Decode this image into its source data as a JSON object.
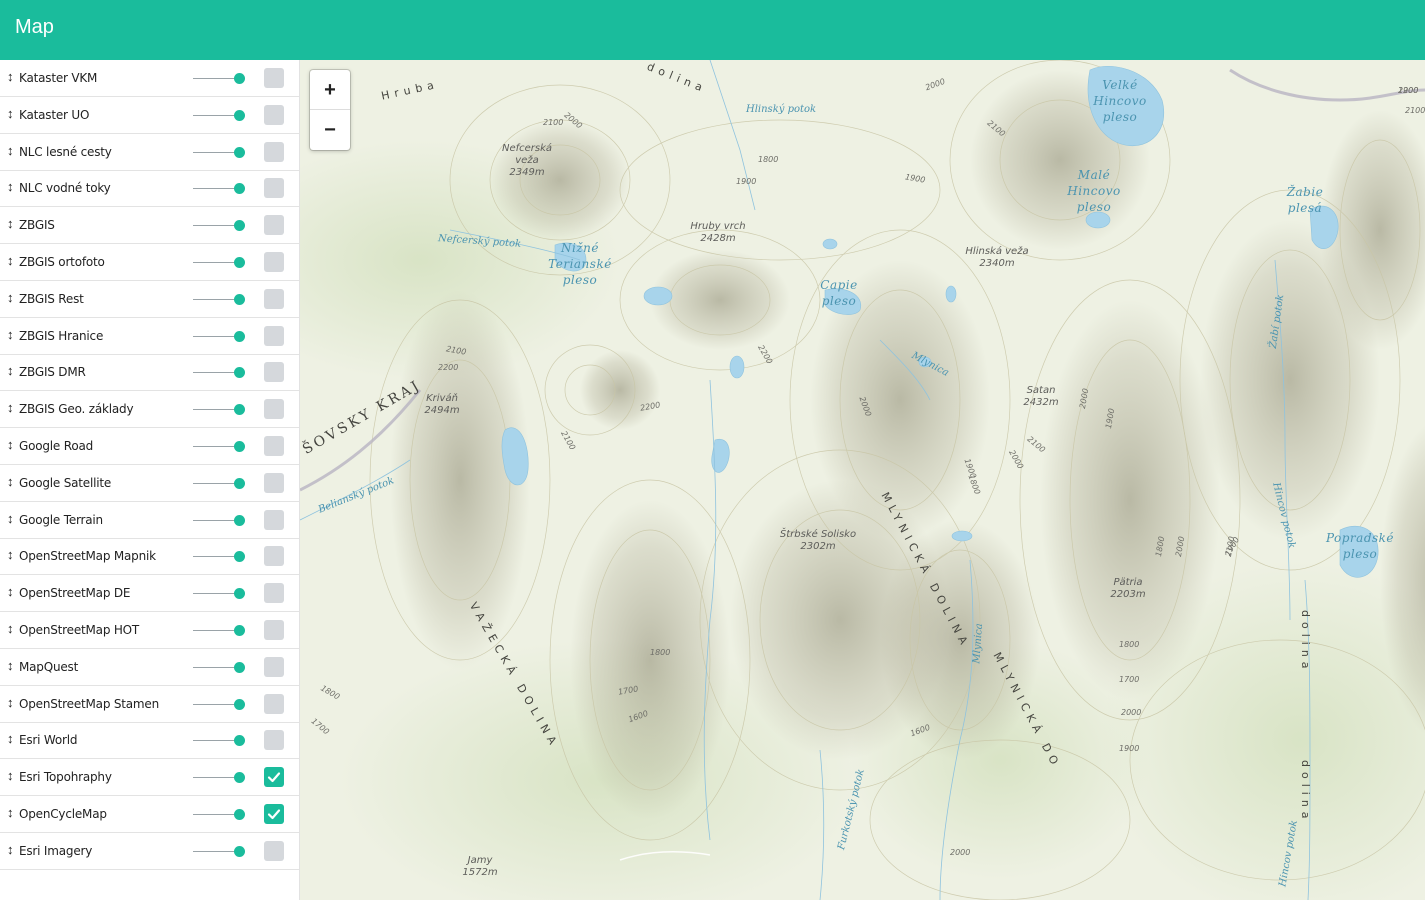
{
  "header": {
    "title": "Map"
  },
  "layers": [
    {
      "name": "Kataster VKM",
      "checked": false
    },
    {
      "name": "Kataster UO",
      "checked": false
    },
    {
      "name": "NLC lesné cesty",
      "checked": false
    },
    {
      "name": "NLC vodné toky",
      "checked": false
    },
    {
      "name": "ZBGIS",
      "checked": false
    },
    {
      "name": "ZBGIS ortofoto",
      "checked": false
    },
    {
      "name": "ZBGIS Rest",
      "checked": false
    },
    {
      "name": "ZBGIS Hranice",
      "checked": false
    },
    {
      "name": "ZBGIS DMR",
      "checked": false
    },
    {
      "name": "ZBGIS Geo. základy",
      "checked": false
    },
    {
      "name": "Google Road",
      "checked": false
    },
    {
      "name": "Google Satellite",
      "checked": false
    },
    {
      "name": "Google Terrain",
      "checked": false
    },
    {
      "name": "OpenStreetMap Mapnik",
      "checked": false
    },
    {
      "name": "OpenStreetMap DE",
      "checked": false
    },
    {
      "name": "OpenStreetMap HOT",
      "checked": false
    },
    {
      "name": "MapQuest",
      "checked": false
    },
    {
      "name": "OpenStreetMap Stamen",
      "checked": false
    },
    {
      "name": "Esri World",
      "checked": false
    },
    {
      "name": "Esri Topohraphy",
      "checked": true
    },
    {
      "name": "OpenCycleMap",
      "checked": true
    },
    {
      "name": "Esri Imagery",
      "checked": false
    }
  ],
  "layer_icons": {
    "drag": "drag-handle-icon",
    "check": "check-icon"
  },
  "zoom": {
    "in_label": "+",
    "out_label": "−"
  },
  "map": {
    "peaks": [
      {
        "name": "Nefcerská veža",
        "elevation": "2349m"
      },
      {
        "name": "Hruby vrch",
        "elevation": "2428m"
      },
      {
        "name": "Hlinská veža",
        "elevation": "2340m"
      },
      {
        "name": "Kriváň",
        "elevation": "2494m"
      },
      {
        "name": "Satan",
        "elevation": "2432m"
      },
      {
        "name": "Štrbské Solisko",
        "elevation": "2302m"
      },
      {
        "name": "Pätria",
        "elevation": "2203m"
      },
      {
        "name": "Jamy",
        "elevation": "1572m"
      }
    ],
    "lakes": [
      {
        "name": "Velké Hincovo pleso"
      },
      {
        "name": "Malé Hincovo pleso"
      },
      {
        "name": "Žabie plesá"
      },
      {
        "name": "Nižné Terianské pleso"
      },
      {
        "name": "Capie pleso"
      },
      {
        "name": "Popradské pleso"
      }
    ],
    "streams": [
      "Hlinský potok",
      "Nefcerský potok",
      "Mlynica",
      "Belianský potok",
      "Žabí potok",
      "Hincov potok",
      "Furkotský potok",
      "Mlynica",
      "Hincov potok"
    ],
    "valleys": [
      "MLYNICKÁ DOLINA",
      "VAŽECKÁ DOLINA",
      "MLYNICKÁ DO",
      "dolina",
      "dolina",
      "Hruba",
      "dolina"
    ],
    "regions": [
      "ŠOVSKY KRAJ"
    ],
    "contours": [
      "2100",
      "2000",
      "1800",
      "1900",
      "1900",
      "2000",
      "2100",
      "2100",
      "2200",
      "2200",
      "2100",
      "2200",
      "2000",
      "1900",
      "1800",
      "2000",
      "2100",
      "2000",
      "1900",
      "1800",
      "2000",
      "1900",
      "1800",
      "1700",
      "2000",
      "1900",
      "1800",
      "1700",
      "1600",
      "1800",
      "1700",
      "1600",
      "2000",
      "1900",
      "1700",
      "2100",
      "2200",
      "2100"
    ],
    "colors": {
      "land": "#eef1e3",
      "forest": "#dfe8cf",
      "water": "#a8d4eb",
      "contour": "#c9c6a6",
      "relief": "#a39f86",
      "accent": "#1abc9c"
    }
  }
}
